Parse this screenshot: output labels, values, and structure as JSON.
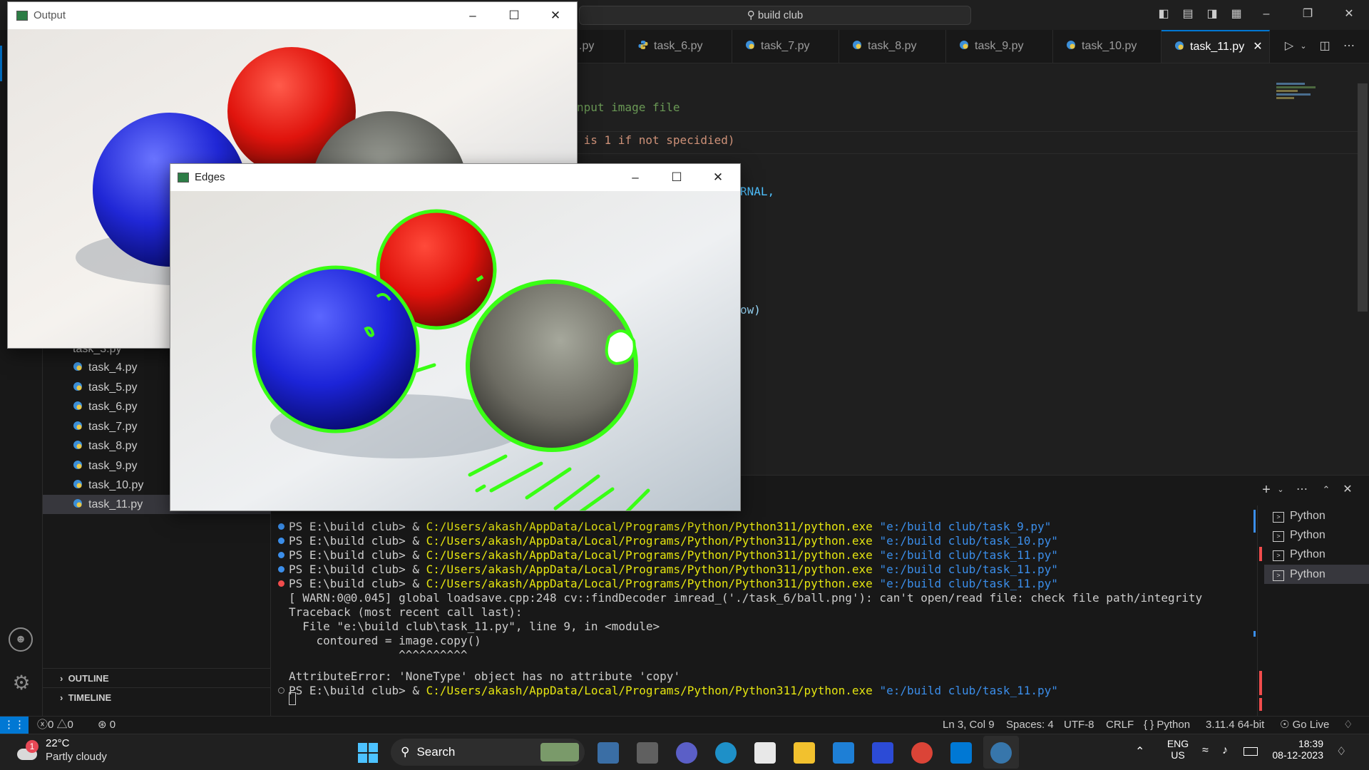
{
  "title_bar": {
    "search_label": "build club"
  },
  "tabs": [
    {
      "label": ".py"
    },
    {
      "label": "task_6.py"
    },
    {
      "label": "task_7.py"
    },
    {
      "label": "task_8.py"
    },
    {
      "label": "task_9.py"
    },
    {
      "label": "task_10.py"
    },
    {
      "label": "task_11.py",
      "active": true
    }
  ],
  "editor": {
    "lines": [
      "nput image file",
      " is 1 if not specidied)",
      "RNAL,",
      "ow)"
    ]
  },
  "explorer": {
    "files": [
      "task_3.py",
      "task_4.py",
      "task_5.py",
      "task_6.py",
      "task_7.py",
      "task_8.py",
      "task_9.py",
      "task_10.py",
      "task_11.py"
    ],
    "selected": "task_11.py",
    "outline_label": "OUTLINE",
    "timeline_label": "TIMELINE"
  },
  "terminal": {
    "prompt": "PS E:\\build club> & ",
    "python_path": "C:/Users/akash/AppData/Local/Programs/Python/Python311/python.exe",
    "runs": [
      {
        "script": "\"e:/build club/task_9.py\"",
        "status": "ok"
      },
      {
        "script": "\"e:/build club/task_10.py\"",
        "status": "ok"
      },
      {
        "script": "\"e:/build club/task_11.py\"",
        "status": "ok"
      },
      {
        "script": "\"e:/build club/task_11.py\"",
        "status": "ok"
      },
      {
        "script": "\"e:/build club/task_11.py\"",
        "status": "error"
      }
    ],
    "error_lines": [
      "[ WARN:0@0.045] global loadsave.cpp:248 cv::findDecoder imread_('./task_6/ball.png'): can't open/read file: check file path/integrity",
      "Traceback (most recent call last):",
      "  File \"e:\\build club\\task_11.py\", line 9, in <module>",
      "    contoured = image.copy()",
      "                ^^^^^^^^^^",
      "",
      "AttributeError: 'NoneType' object has no attribute 'copy'"
    ],
    "last_run": "\"e:/build club/task_11.py\"",
    "sessions": [
      "Python",
      "Python",
      "Python",
      "Python"
    ]
  },
  "status_bar": {
    "errors": "0",
    "warnings": "0",
    "ports": "0",
    "position": "Ln 3, Col 9",
    "spaces": "Spaces: 4",
    "encoding": "UTF-8",
    "eol": "CRLF",
    "language": "Python",
    "interpreter": "3.11.4 64-bit",
    "go_live": "Go Live"
  },
  "windows": {
    "output_title": "Output",
    "edges_title": "Edges"
  },
  "taskbar": {
    "temperature": "22°C",
    "weather": "Partly cloudy",
    "weather_badge": "1",
    "search_label": "Search",
    "lang_line1": "ENG",
    "lang_line2": "US",
    "time": "18:39",
    "date": "08-12-2023"
  },
  "colors": {
    "accent": "#0078d4",
    "contour": "#39ff14",
    "terminal_path": "#e5e510",
    "terminal_string": "#3b8eea"
  }
}
